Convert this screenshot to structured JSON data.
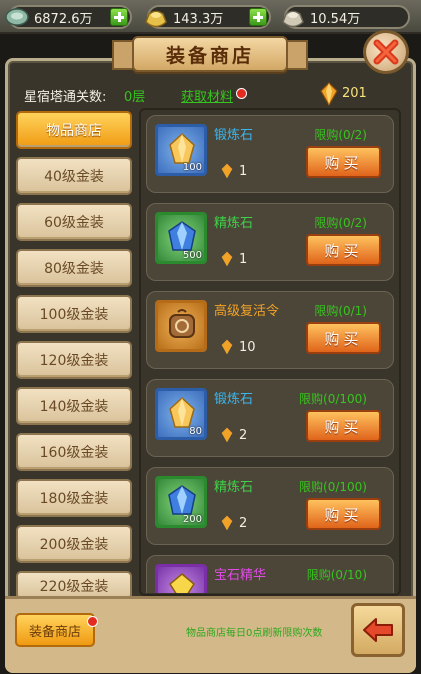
{
  "resources": [
    {
      "icon": "jade-coin-icon",
      "value": "6872.6万"
    },
    {
      "icon": "gold-ingot-icon",
      "value": "143.3万"
    },
    {
      "icon": "silver-ingot-icon",
      "value": "10.54万"
    }
  ],
  "title": "装备商店",
  "info": {
    "tower_label": "星宿塔通关数:",
    "tower_value": "0层",
    "get_material_link": "获取材料",
    "currency_count": "201"
  },
  "nav": [
    {
      "label": "物品商店",
      "active": true
    },
    {
      "label": "40级金装"
    },
    {
      "label": "60级金装"
    },
    {
      "label": "80级金装"
    },
    {
      "label": "100级金装"
    },
    {
      "label": "120级金装"
    },
    {
      "label": "140级金装"
    },
    {
      "label": "160级金装"
    },
    {
      "label": "180级金装"
    },
    {
      "label": "200级金装"
    },
    {
      "label": "220级金装"
    }
  ],
  "items": [
    {
      "name": "锻炼石",
      "qty": "100",
      "price": "1",
      "limit": "限购(0/2)",
      "buy": "购买",
      "color": "blue"
    },
    {
      "name": "精炼石",
      "qty": "500",
      "price": "1",
      "limit": "限购(0/2)",
      "buy": "购买",
      "color": "green"
    },
    {
      "name": "高级复活令",
      "qty": "",
      "price": "10",
      "limit": "限购(0/1)",
      "buy": "购买",
      "color": "orange"
    },
    {
      "name": "锻炼石",
      "qty": "80",
      "price": "2",
      "limit": "限购(0/100)",
      "buy": "购买",
      "color": "blue"
    },
    {
      "name": "精炼石",
      "qty": "200",
      "price": "2",
      "limit": "限购(0/100)",
      "buy": "购买",
      "color": "green"
    },
    {
      "name": "宝石精华",
      "qty": "",
      "price": "",
      "limit": "限购(0/10)",
      "buy": "",
      "color": "purple"
    }
  ],
  "bottom": {
    "shop_tab": "装备商店",
    "refresh_note": "物品商店每日0点刷新限购次数"
  }
}
